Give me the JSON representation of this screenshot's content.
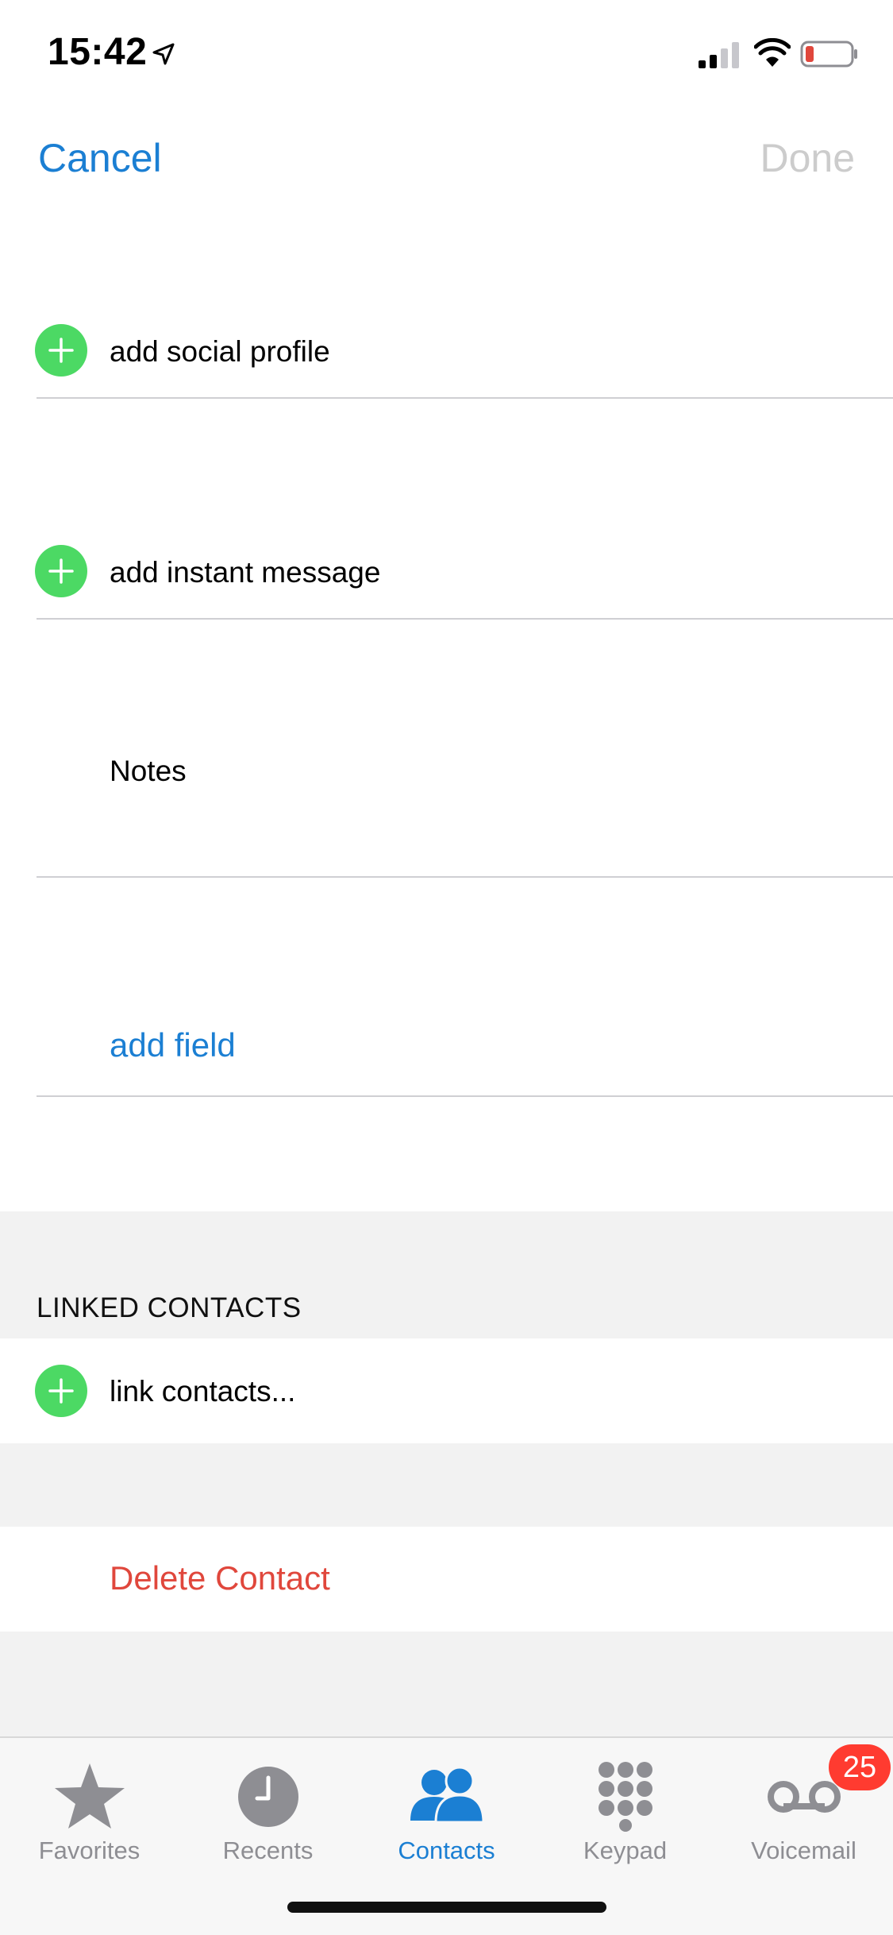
{
  "status_bar": {
    "time": "15:42",
    "battery_color": "#e0473c"
  },
  "nav": {
    "cancel_label": "Cancel",
    "done_label": "Done"
  },
  "rows": {
    "add_social_profile": "add social profile",
    "add_instant_message": "add instant message",
    "notes_label": "Notes",
    "add_field": "add field"
  },
  "linked_contacts": {
    "header": "LINKED CONTACTS",
    "link_label": "link contacts..."
  },
  "delete_label": "Delete Contact",
  "tab_bar": {
    "tabs": [
      {
        "label": "Favorites",
        "icon": "star-icon",
        "active": false
      },
      {
        "label": "Recents",
        "icon": "clock-icon",
        "active": false
      },
      {
        "label": "Contacts",
        "icon": "contacts-icon",
        "active": true
      },
      {
        "label": "Keypad",
        "icon": "keypad-icon",
        "active": false
      },
      {
        "label": "Voicemail",
        "icon": "voicemail-icon",
        "active": false
      }
    ],
    "voicemail_badge": "25"
  },
  "colors": {
    "accent": "#1b7fd3",
    "add_green": "#4cd964",
    "destructive": "#e0473c",
    "badge": "#ff3b30"
  }
}
